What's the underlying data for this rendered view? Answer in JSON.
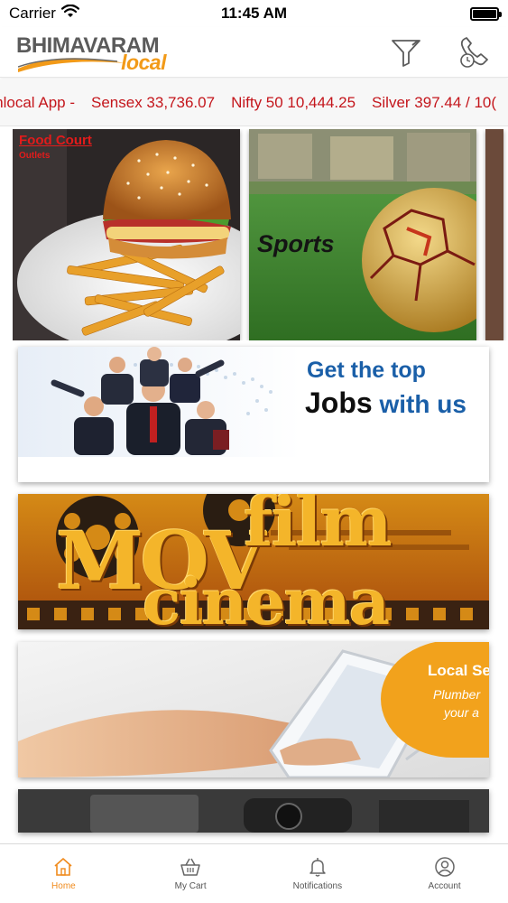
{
  "status_bar": {
    "carrier": "Carrier",
    "time": "11:45 AM"
  },
  "header": {
    "logo_top": "BHIMAVARAM",
    "logo_bottom": "local",
    "filter_icon": "filter-funnel-icon",
    "call_icon": "phone-clock-icon"
  },
  "ticker": {
    "items": [
      "amlocal App -",
      "Sensex 33,736.07",
      "Nifty 50 10,444.25",
      "Silver 397.44 / 10("
    ]
  },
  "tiles": {
    "food": {
      "label": "Food Court",
      "sub": "Outlets"
    },
    "sports": {
      "label": "Sports"
    }
  },
  "banners": {
    "jobs": {
      "line1": "Get the top",
      "line2_bold": "Jobs",
      "line2_rest": " with us"
    },
    "movie": {
      "word1": "MOV",
      "word2": "film",
      "word3": "cinema"
    },
    "local": {
      "title": "Local Se",
      "sub1": "Plumber",
      "sub2": "your a"
    }
  },
  "colors": {
    "accent": "#f08a1c",
    "ticker_text": "#c4161c",
    "jobs_blue": "#1a5fa8"
  },
  "tab_bar": {
    "tabs": [
      {
        "label": "Home",
        "icon": "home-icon",
        "active": true
      },
      {
        "label": "My Cart",
        "icon": "cart-basket-icon",
        "active": false
      },
      {
        "label": "Notifications",
        "icon": "bell-icon",
        "active": false
      },
      {
        "label": "Account",
        "icon": "user-icon",
        "active": false
      }
    ]
  }
}
